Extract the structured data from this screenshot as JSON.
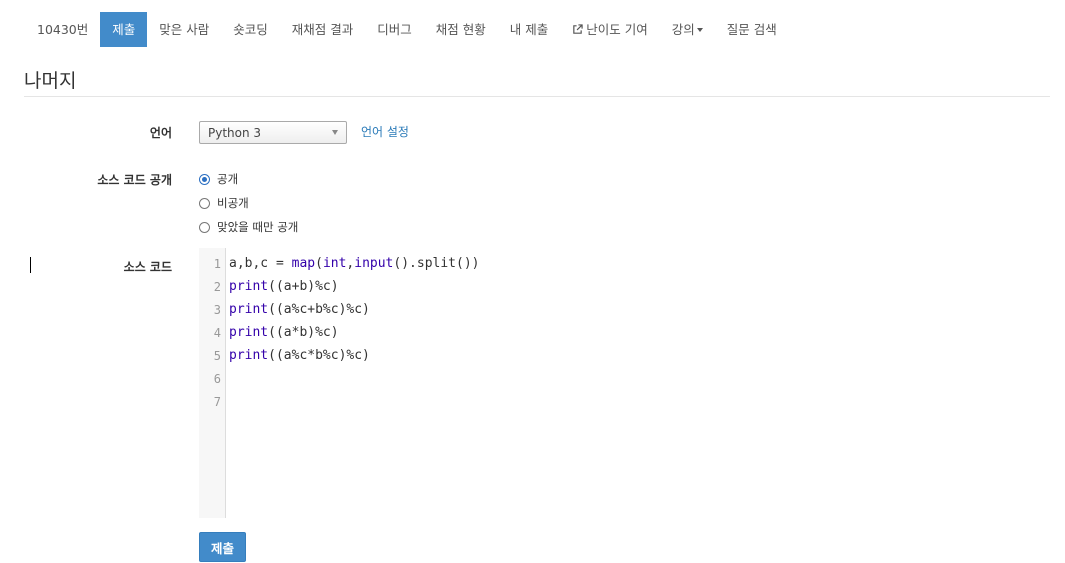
{
  "tabs": [
    {
      "label": "10430번"
    },
    {
      "label": "제출",
      "active": true
    },
    {
      "label": "맞은 사람"
    },
    {
      "label": "숏코딩"
    },
    {
      "label": "재채점 결과"
    },
    {
      "label": "디버그"
    },
    {
      "label": "채점 현황"
    },
    {
      "label": "내 제출"
    },
    {
      "label": "난이도 기여",
      "icon": "external-link-icon"
    },
    {
      "label": "강의",
      "icon": "caret-down-icon"
    },
    {
      "label": "질문 검색"
    }
  ],
  "page": {
    "title": "나머지"
  },
  "form": {
    "language_label": "언어",
    "language_value": "Python 3",
    "language_settings_link": "언어 설정",
    "visibility_label": "소스 코드 공개",
    "visibility_options": [
      {
        "label": "공개",
        "checked": true
      },
      {
        "label": "비공개",
        "checked": false
      },
      {
        "label": "맞았을 때만 공개",
        "checked": false
      }
    ],
    "source_label": "소스 코드",
    "submit_label": "제출"
  },
  "editor": {
    "line_numbers": [
      "1",
      "2",
      "3",
      "4",
      "5",
      "6",
      "7"
    ],
    "lines": [
      "a,b,c = map(int,input().split())",
      "print((a+b)%c)",
      "print((a%c+b%c)%c)",
      "print((a*b)%c)",
      "print((a%c*b%c)%c)",
      "",
      ""
    ]
  },
  "colors": {
    "accent": "#428bca",
    "link": "#2a7ab8",
    "keyword": "#3300aa"
  }
}
